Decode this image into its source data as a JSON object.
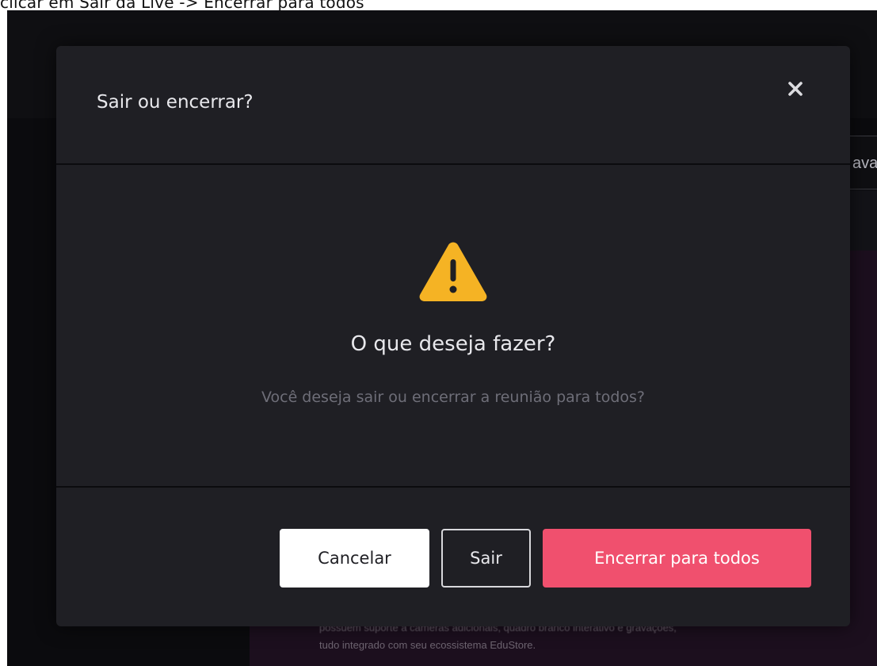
{
  "caption": "clicar em Sair da Live -> Encerrar para todos",
  "background": {
    "tab_partial_label": "ava",
    "blurred_text_line1": "possuem suporte a câmeras adicionais, quadro branco interativo e gravações,",
    "blurred_text_line2": "tudo integrado com seu ecossistema EduStore."
  },
  "modal": {
    "title": "Sair ou encerrar?",
    "close_icon": "close-icon",
    "warning_icon": "warning-triangle-icon",
    "heading": "O que deseja fazer?",
    "message": "Você deseja sair ou encerrar a reunião para todos?",
    "buttons": {
      "cancel": "Cancelar",
      "exit": "Sair",
      "end_for_all": "Encerrar para todos"
    }
  },
  "colors": {
    "modal_bg": "#1f1f24",
    "accent_danger": "#f0506e",
    "warning": "#f5b324",
    "backdrop": "#0b0b0e"
  }
}
